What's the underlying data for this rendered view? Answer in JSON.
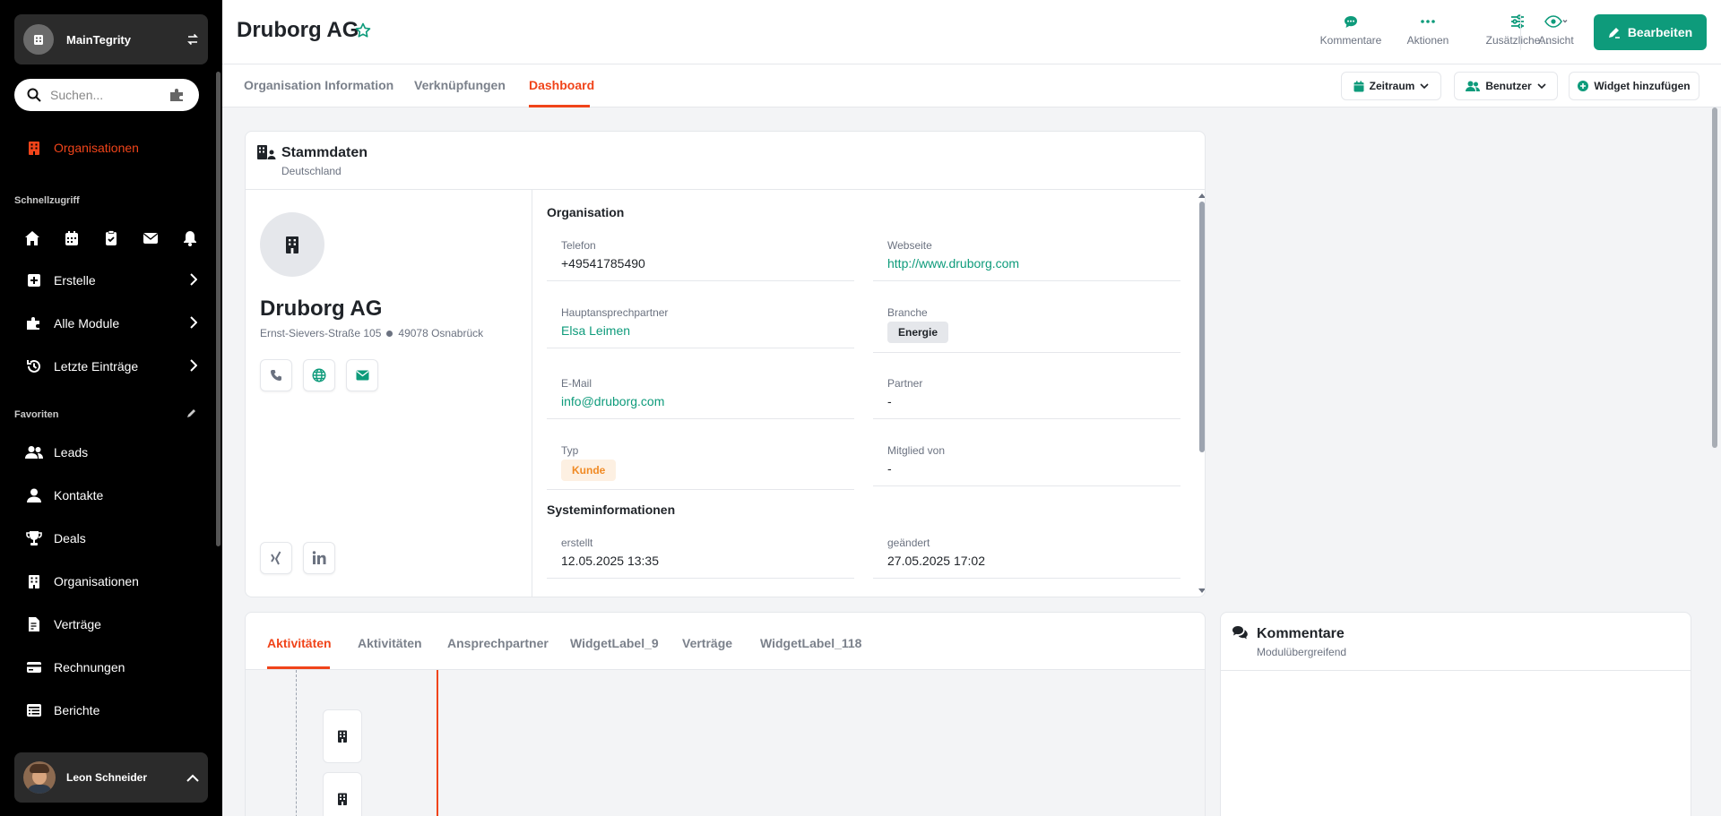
{
  "app": {
    "name": "MainTegrity"
  },
  "sidebar": {
    "search_placeholder": "Suchen...",
    "active_item": "Organisationen",
    "quick_access_title": "Schnellzugriff",
    "quick_icons": [
      "home-icon",
      "calendar-icon",
      "clipboard-check-icon",
      "mail-icon",
      "bell-icon"
    ],
    "menus": [
      "Erstelle",
      "Alle Module",
      "Letzte Einträge"
    ],
    "favorites_title": "Favoriten",
    "favorites": [
      "Leads",
      "Kontakte",
      "Deals",
      "Organisationen",
      "Verträge",
      "Rechnungen",
      "Berichte"
    ],
    "user_name": "Leon Schneider"
  },
  "header": {
    "title": "Druborg AG",
    "actions": [
      "Kommentare",
      "Aktionen",
      "Zusätzliche...",
      "Ansicht"
    ],
    "edit_label": "Bearbeiten"
  },
  "tabs": {
    "items": [
      "Organisation Information",
      "Verknüpfungen",
      "Dashboard"
    ],
    "active": "Dashboard",
    "buttons": [
      "Zeitraum",
      "Benutzer",
      "Widget hinzufügen"
    ]
  },
  "stammdaten": {
    "title": "Stammdaten",
    "subtitle": "Deutschland",
    "company_name": "Druborg AG",
    "street": "Ernst-Sievers-Straße 105",
    "city": "49078 Osnabrück",
    "section_org": "Organisation",
    "fields": {
      "telefon_label": "Telefon",
      "telefon": "+49541785490",
      "webseite_label": "Webseite",
      "webseite": "http://www.druborg.com",
      "ansprech_label": "Hauptansprechpartner",
      "ansprech": "Elsa Leimen",
      "branche_label": "Branche",
      "branche": "Energie",
      "email_label": "E-Mail",
      "email": "info@druborg.com",
      "partner_label": "Partner",
      "partner": "-",
      "typ_label": "Typ",
      "typ": "Kunde",
      "mitglied_label": "Mitglied von",
      "mitglied": "-"
    },
    "section_sys": "Systeminformationen",
    "sys": {
      "erstellt_label": "erstellt",
      "erstellt": "12.05.2025 13:35",
      "geaendert_label": "geändert",
      "geaendert": "27.05.2025 17:02"
    }
  },
  "bottom_tabs": {
    "items": [
      "Aktivitäten",
      "Aktivitäten",
      "Ansprechpartner",
      "WidgetLabel_9",
      "Verträge",
      "WidgetLabel_118"
    ],
    "active_index": 0
  },
  "kommentare": {
    "title": "Kommentare",
    "subtitle": "Modulübergreifend"
  },
  "colors": {
    "accent": "#f0441a",
    "primary": "#0e9b7b",
    "sidebar_bg": "#000000"
  }
}
